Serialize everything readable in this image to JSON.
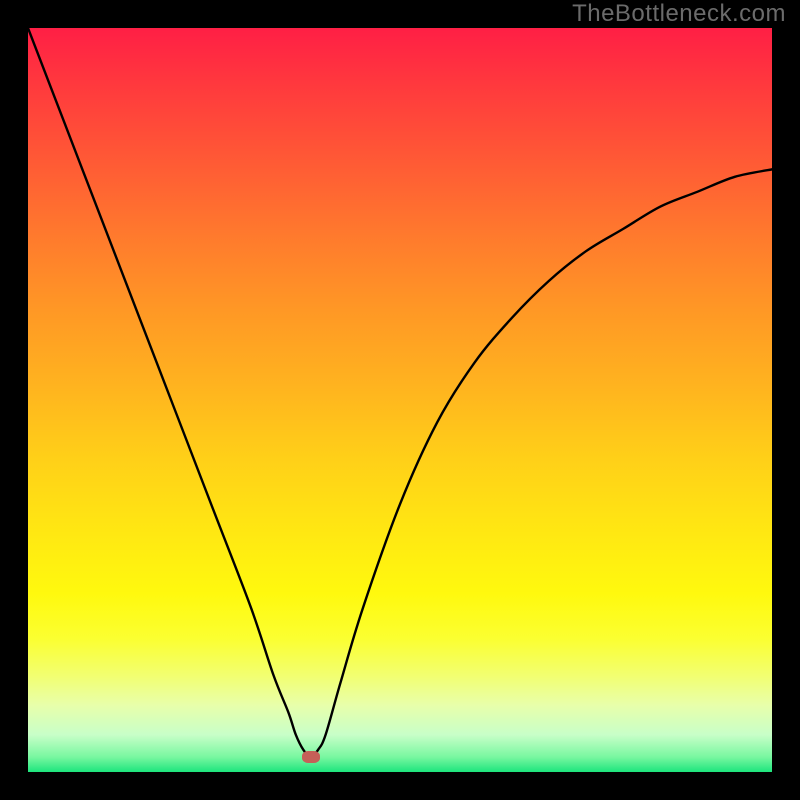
{
  "watermark": "TheBottleneck.com",
  "colors": {
    "background": "#000000",
    "watermark_text": "#6b6b6b",
    "curve": "#000000",
    "dip_marker": "#c56058",
    "gradient_top": "#ff1f45",
    "gradient_bottom": "#1de57d"
  },
  "chart_data": {
    "type": "line",
    "title": "",
    "xlabel": "",
    "ylabel": "",
    "xlim": [
      0,
      100
    ],
    "ylim": [
      0,
      100
    ],
    "grid": false,
    "legend": false,
    "annotations": [
      {
        "text": "TheBottleneck.com",
        "position": "top-right"
      }
    ],
    "dip_x": 38,
    "dip_marker_value": 2,
    "series": [
      {
        "name": "bottleneck-curve",
        "x": [
          0,
          5,
          10,
          15,
          20,
          25,
          30,
          33,
          35,
          36,
          37,
          38,
          39,
          40,
          42,
          45,
          50,
          55,
          60,
          65,
          70,
          75,
          80,
          85,
          90,
          95,
          100
        ],
        "values": [
          100,
          87,
          74,
          61,
          48,
          35,
          22,
          13,
          8,
          5,
          3,
          2,
          3,
          5,
          12,
          22,
          36,
          47,
          55,
          61,
          66,
          70,
          73,
          76,
          78,
          80,
          81
        ]
      }
    ]
  }
}
